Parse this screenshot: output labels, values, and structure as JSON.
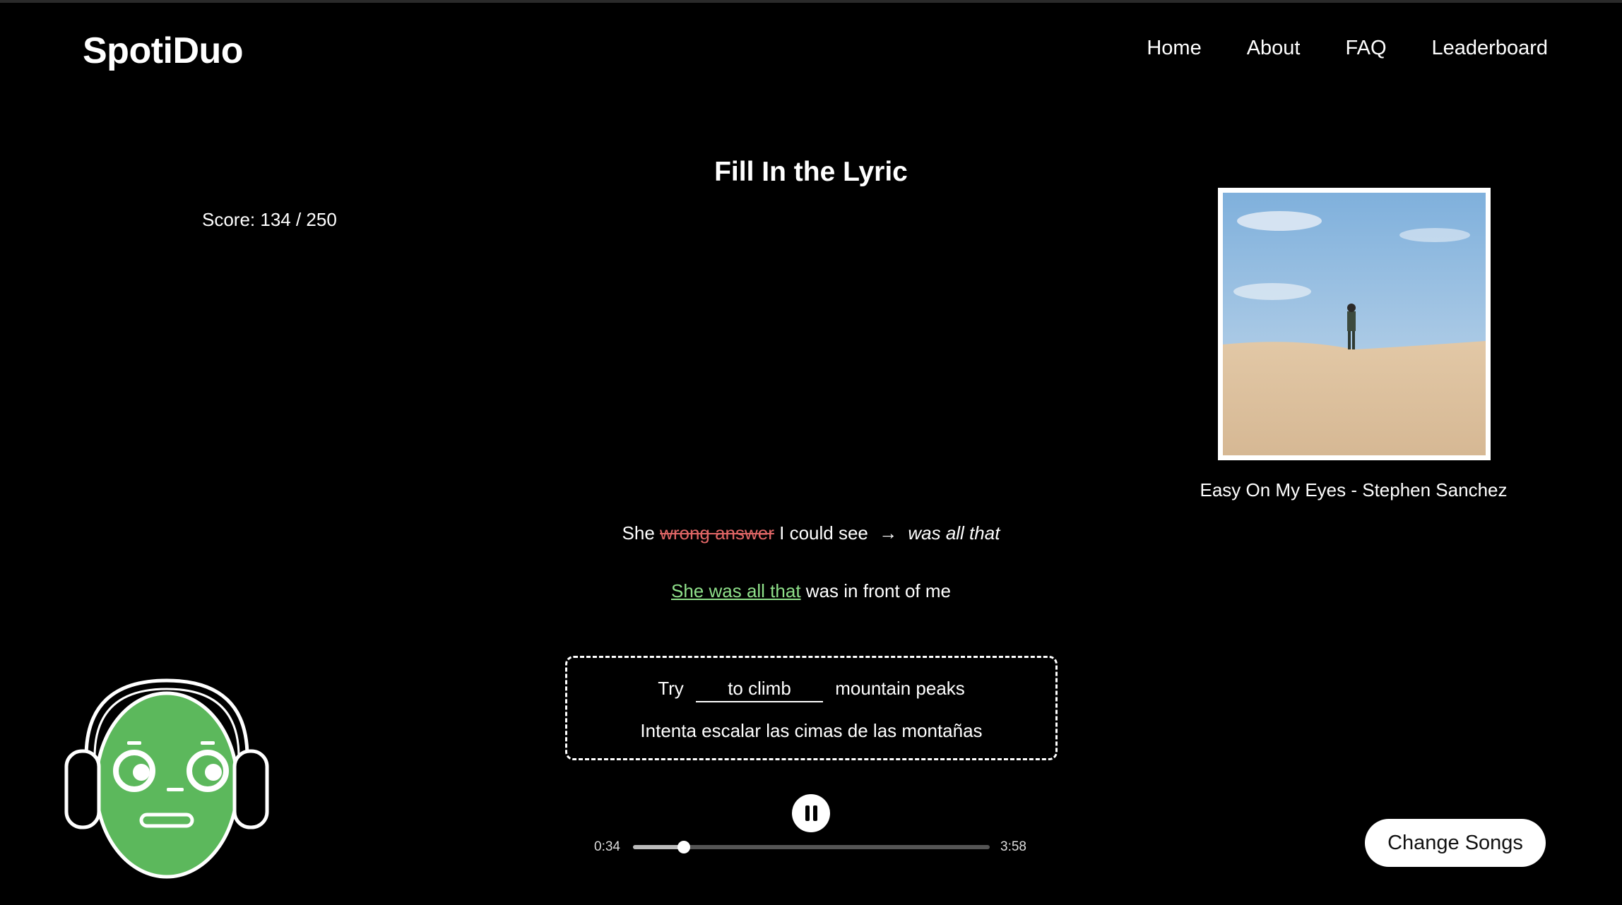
{
  "header": {
    "logo": "SpotiDuo",
    "nav": [
      "Home",
      "About",
      "FAQ",
      "Leaderboard"
    ]
  },
  "game": {
    "title": "Fill In the Lyric",
    "score": "Score: 134 / 250"
  },
  "song": {
    "caption": "Easy On My Eyes - Stephen Sanchez"
  },
  "lyrics": {
    "previous": {
      "prefix": "She",
      "wrong_answer": "wrong answer",
      "suffix": "I could see",
      "arrow": "→",
      "correction": "was all that"
    },
    "answered": {
      "highlight": "She was all that",
      "rest": "was in front of me"
    },
    "current": {
      "prefix": "Try",
      "input_value": "to climb",
      "suffix": "mountain peaks",
      "translation": "Intenta escalar las cimas de las montañas"
    }
  },
  "player": {
    "current_time": "0:34",
    "total_time": "3:58",
    "progress": 0.143,
    "state": "playing"
  },
  "buttons": {
    "change_songs": "Change Songs"
  },
  "icons": {
    "pause": "pause-icon",
    "mascot": "headphones-mascot"
  },
  "colors": {
    "background": "#000000",
    "wrong": "#e06666",
    "correct": "#8fe08a",
    "mascot": "#5cb85c"
  }
}
